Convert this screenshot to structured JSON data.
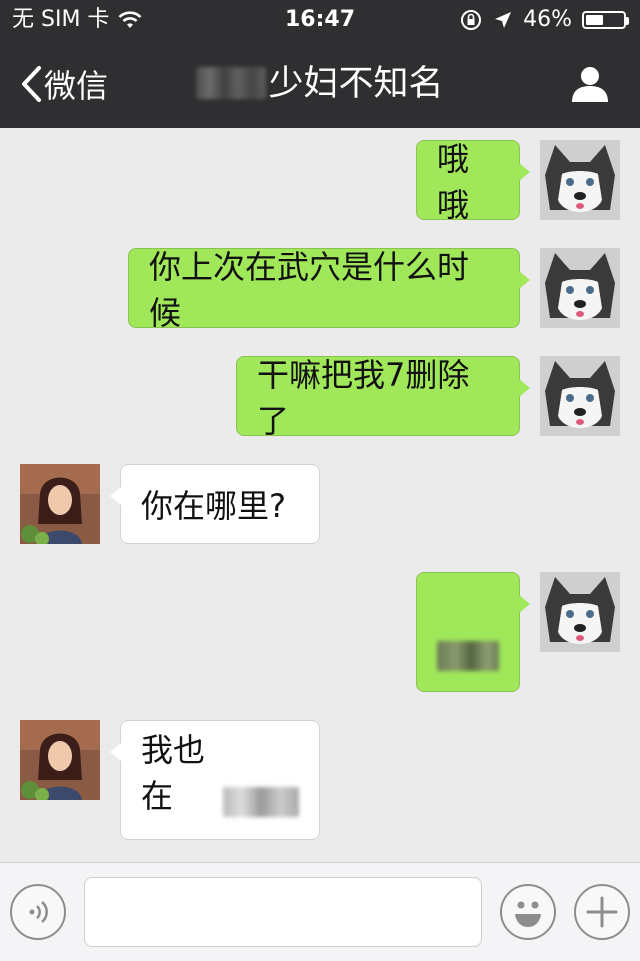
{
  "status_bar": {
    "carrier": "无 SIM 卡",
    "time": "16:47",
    "battery_percent": "46%",
    "battery_level": 0.46
  },
  "nav": {
    "back_label": "微信",
    "title_visible": "少妇不知名"
  },
  "messages": [
    {
      "side": "right",
      "text": "哦哦"
    },
    {
      "side": "right",
      "text": "你上次在武穴是什么时候"
    },
    {
      "side": "right",
      "text": "干嘛把我7删除了"
    },
    {
      "side": "left",
      "text": "你在哪里?"
    },
    {
      "side": "right",
      "text": ""
    },
    {
      "side": "left",
      "text": "我也在"
    }
  ],
  "input_bar": {
    "placeholder": ""
  },
  "colors": {
    "header_bg": "#2f2f31",
    "chat_bg": "#ebebeb",
    "bubble_sent": "#a0e75a",
    "bubble_received": "#ffffff"
  },
  "icons": [
    "back-chevron-icon",
    "profile-icon",
    "wifi-icon",
    "lock-rotation-icon",
    "location-arrow-icon",
    "voice-icon",
    "emoji-icon",
    "plus-icon"
  ]
}
